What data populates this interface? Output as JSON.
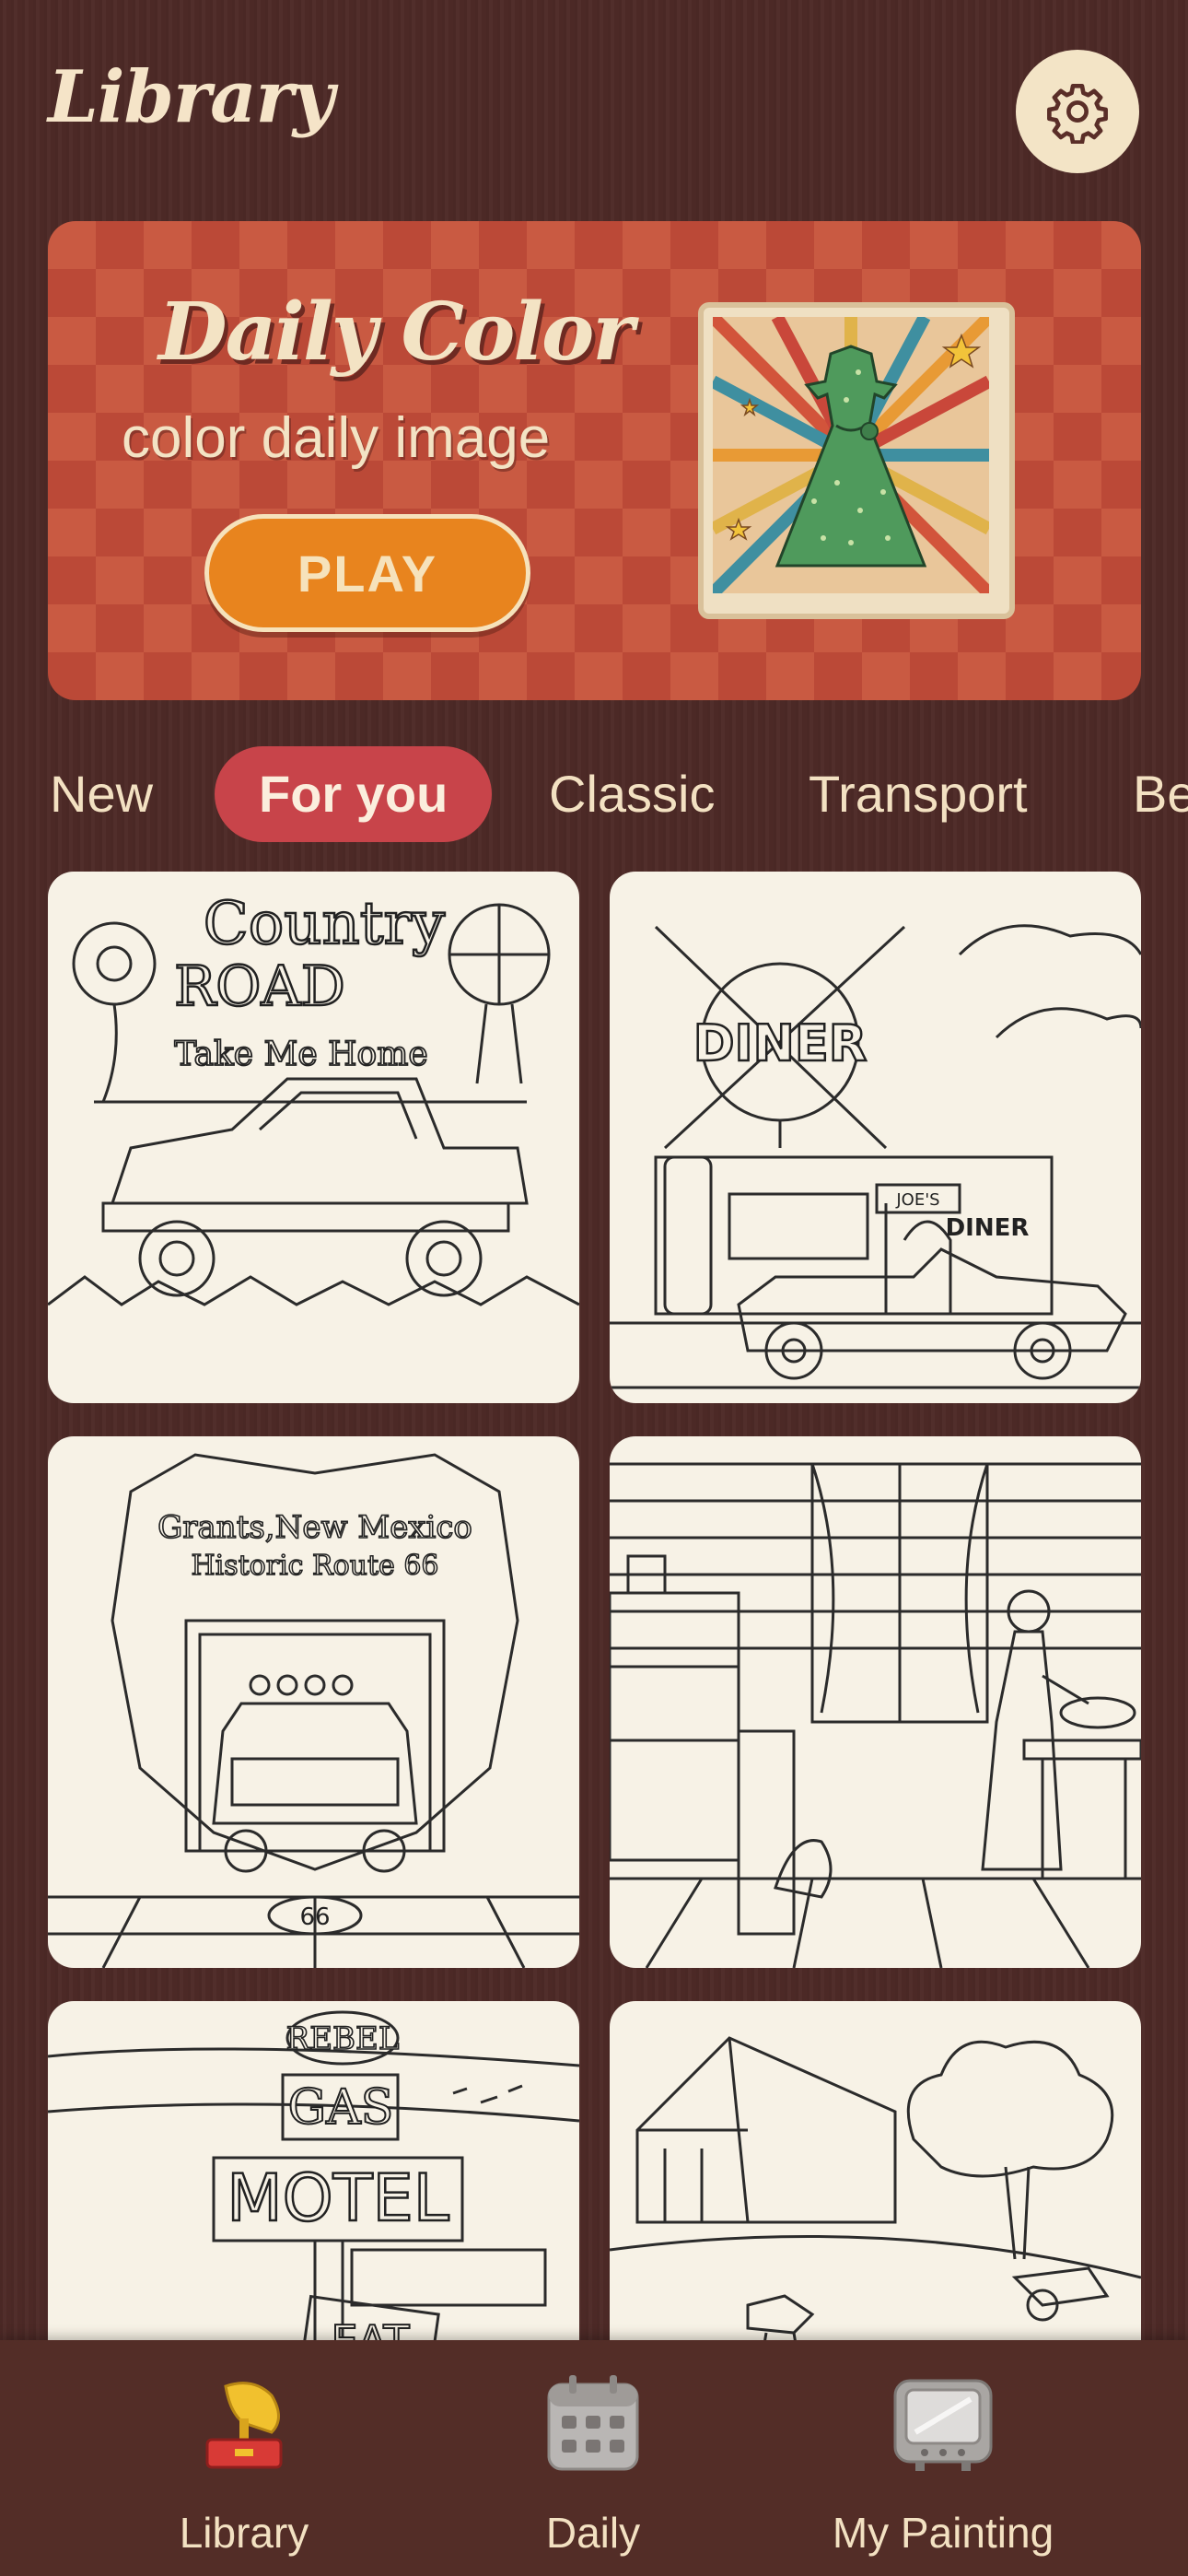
{
  "header": {
    "title": "Library",
    "settings_icon": "gear-icon"
  },
  "banner": {
    "title": "Daily Color",
    "subtitle": "color daily image",
    "play_label": "PLAY",
    "image_icon": "dress-picture"
  },
  "tabs": [
    {
      "label": "New",
      "active": false
    },
    {
      "label": "For you",
      "active": true
    },
    {
      "label": "Classic",
      "active": false
    },
    {
      "label": "Transport",
      "active": false
    },
    {
      "label": "Be",
      "active": false
    }
  ],
  "cards": [
    {
      "subject": "country-road-truck",
      "lines": [
        "Country",
        "ROAD",
        "Take Me Home"
      ]
    },
    {
      "subject": "diner-car",
      "lines": [
        "DINER",
        "JOE'S",
        "DINER"
      ]
    },
    {
      "subject": "route-66-truck",
      "lines": [
        "Grants,New Mexico",
        "Historic Route 66",
        "66"
      ]
    },
    {
      "subject": "kitchen-woman",
      "lines": []
    },
    {
      "subject": "gas-motel-signs",
      "lines": [
        "REBEL",
        "GAS",
        "MOTEL",
        "EAT"
      ]
    },
    {
      "subject": "farm-barn",
      "lines": []
    }
  ],
  "bottom_nav": [
    {
      "label": "Library",
      "icon": "gramophone-icon",
      "active": true
    },
    {
      "label": "Daily",
      "icon": "calendar-icon",
      "active": false
    },
    {
      "label": "My Painting",
      "icon": "tv-icon",
      "active": false
    }
  ],
  "colors": {
    "accent": "#c8444a",
    "play": "#e8841e",
    "cream": "#f3e1c2"
  }
}
